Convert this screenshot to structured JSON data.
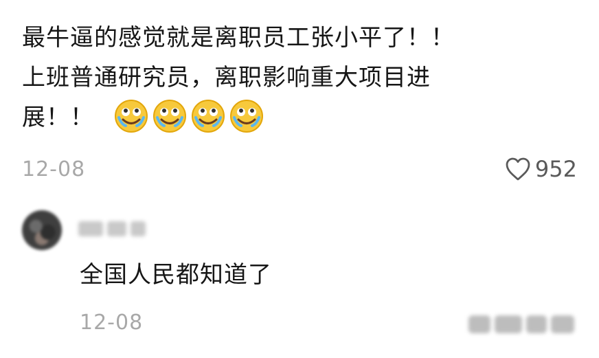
{
  "comment": {
    "text_line1": "最牛逼的感觉就是离职员工张小平了！！",
    "text_line2": "上班普通研究员，离职影响重大项目进",
    "text_line3": "展！！",
    "emoji_icon": "crying-laughing-face-icon",
    "emoji_count": 4,
    "date": "12-08",
    "likes": "952"
  },
  "reply": {
    "text": "全国人民都知道了",
    "date": "12-08"
  },
  "colors": {
    "text": "#161616",
    "meta": "#a8a8a8",
    "like": "#5a5a5a"
  }
}
